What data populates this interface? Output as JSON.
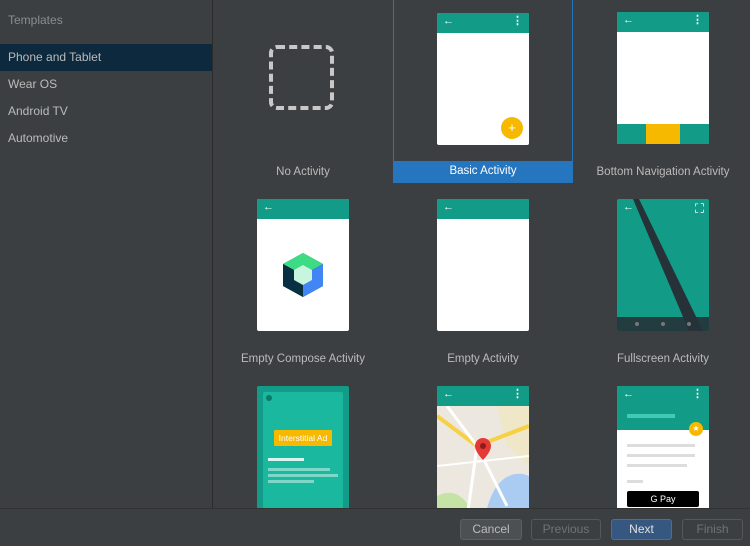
{
  "sidebar": {
    "header": "Templates",
    "items": [
      "Phone and Tablet",
      "Wear OS",
      "Android TV",
      "Automotive"
    ]
  },
  "tiles": {
    "no_activity": "No Activity",
    "basic_activity": "Basic Activity",
    "bottom_nav": "Bottom Navigation Activity",
    "empty_compose": "Empty Compose Activity",
    "empty_activity": "Empty Activity",
    "fullscreen": "Fullscreen Activity",
    "interstitial_badge": "Interstitial Ad",
    "gpay_label": "G Pay"
  },
  "footer": {
    "cancel": "Cancel",
    "previous": "Previous",
    "next": "Next",
    "finish": "Finish"
  },
  "icons": {
    "back": "←",
    "overflow": "⋮",
    "plus": "+",
    "star": "★",
    "expand": "⛶"
  },
  "colors": {
    "appbar": "#129b86",
    "accent": "#2675bf",
    "fab": "#f7b900"
  }
}
